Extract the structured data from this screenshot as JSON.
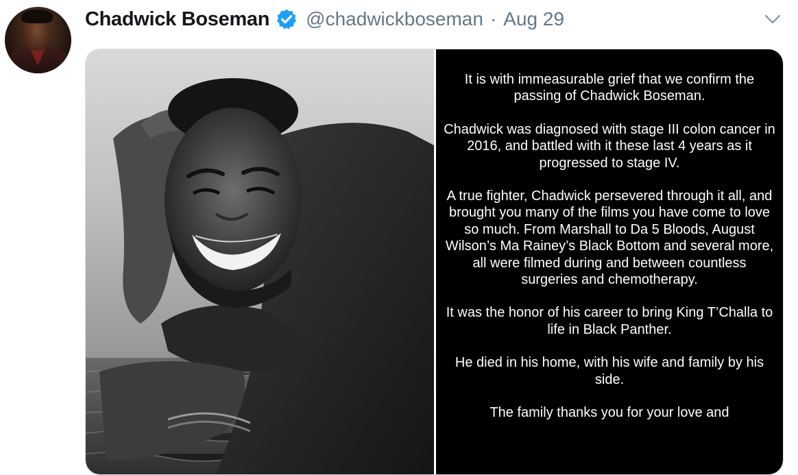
{
  "tweet": {
    "author_name": "Chadwick Boseman",
    "handle": "@chadwickboseman",
    "separator": "·",
    "date": "Aug 29",
    "icons": {
      "verified": "verified-badge-icon",
      "more": "chevron-down-icon"
    },
    "colors": {
      "verified_blue": "#1da1f2",
      "secondary_text": "#657786",
      "name_text": "#14171a",
      "statement_bg": "#000000"
    }
  },
  "statement": {
    "paragraphs": [
      "It is with immeasurable grief that we confirm the passing of Chadwick Boseman.",
      "Chadwick was diagnosed with stage III colon cancer in 2016, and battled with it these last 4 years as it progressed to stage IV.",
      "A true fighter, Chadwick persevered through it all, and brought you many of the films you have come to love so much. From Marshall to Da 5 Bloods, August Wilson’s Ma Rainey’s Black Bottom and several more, all were filmed during and between countless surgeries and chemotherapy.",
      "It was the honor of his career to bring King T’Challa to life in Black Panther.",
      "He died in his home, with his wife and family by his side.",
      "The family thanks you for your love and"
    ]
  }
}
